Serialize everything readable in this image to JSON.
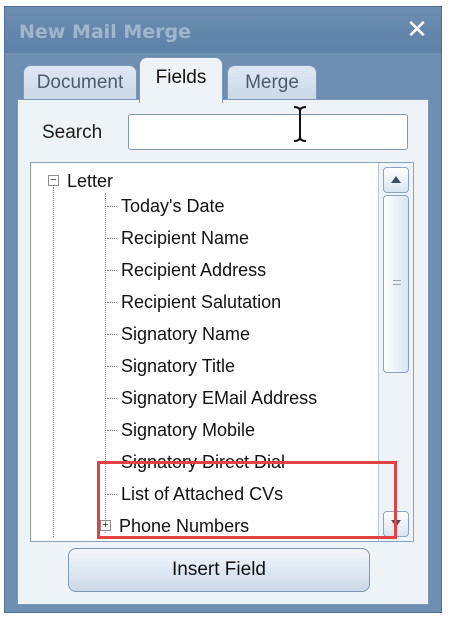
{
  "window": {
    "title": "New Mail Merge",
    "close_glyph": "✕"
  },
  "tabs": [
    {
      "label": "Document",
      "active": false
    },
    {
      "label": "Fields",
      "active": true
    },
    {
      "label": "Merge",
      "active": false
    }
  ],
  "search": {
    "label": "Search",
    "value": ""
  },
  "tree": {
    "root": {
      "label": "Letter",
      "expander": "−"
    },
    "items": [
      "Today's Date",
      "Recipient Name",
      "Recipient Address",
      "Recipient Salutation",
      "Signatory Name",
      "Signatory Title",
      "Signatory EMail Address",
      "Signatory Mobile",
      "Signatory Direct Dial",
      "List of Attached CVs"
    ],
    "phone": {
      "label": "Phone Numbers",
      "expander": "+"
    }
  },
  "buttons": {
    "insert_field": "Insert Field"
  },
  "colors": {
    "highlight": "#e34242",
    "titlebar": "#6d8db1",
    "panel": "#eef3f8"
  },
  "icons": {
    "close": "close-icon",
    "cursor": "text-cursor-icon"
  }
}
